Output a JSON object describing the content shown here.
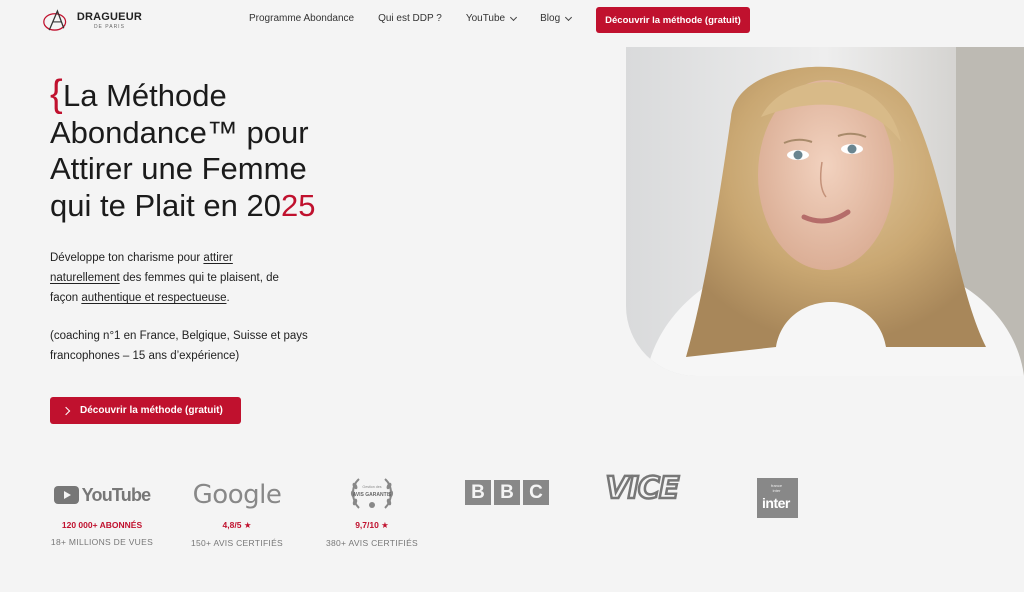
{
  "header": {
    "logo": {
      "main": "DRAGUEUR",
      "sub": "DE PARIS"
    },
    "nav": [
      {
        "label": "Programme Abondance"
      },
      {
        "label": "Qui est DDP ?"
      },
      {
        "label": "YouTube"
      },
      {
        "label": "Blog"
      }
    ],
    "cta": "Découvrir la méthode (gratuit)"
  },
  "hero": {
    "brace": "{",
    "title_lines": [
      "La Méthode",
      "Abondance™ pour",
      "Attirer une Femme",
      "qui te Plait en 20"
    ],
    "title_accent": "25",
    "desc": {
      "p1": "Développe ton charisme pour ",
      "link1": "attirer",
      "link2": "naturellement",
      "p2": " des femmes qui te plaisent",
      "p3": ", de façon ",
      "link3": "authentique et respectueuse",
      "p4": "."
    },
    "note": "(coaching n°1 en France, Belgique, Suisse et pays francophones – 15 ans d’expérience)",
    "cta": "Découvrir la méthode (gratuit)"
  },
  "proof": {
    "youtube": {
      "logo": "YouTube",
      "stat": "120 000+ ABONNÉS",
      "sub": "18+ MILLIONS DE VUES"
    },
    "google": {
      "logo": "Google",
      "stat": "4,8/5 ★",
      "sub": "150+ AVIS CERTIFIÉS"
    },
    "avis": {
      "logo_top": "Gestion des",
      "logo_main": "AVIS GARANTIS",
      "stat": "9,7/10 ★",
      "sub": "380+ AVIS CERTIFIÉS"
    },
    "bbc": {
      "letters": [
        "B",
        "B",
        "C"
      ]
    },
    "vice": {
      "logo": "VICE"
    },
    "inter": {
      "small_top": "france",
      "small_bottom": "inter",
      "big": "inter"
    }
  },
  "colors": {
    "accent": "#c0112e",
    "background": "#f4f4f4",
    "logo_gray": "#888888"
  },
  "icons": [
    "dragueur-logo-icon",
    "chevron-down-icon",
    "chevron-right-icon",
    "youtube-icon",
    "laurel-icon"
  ]
}
